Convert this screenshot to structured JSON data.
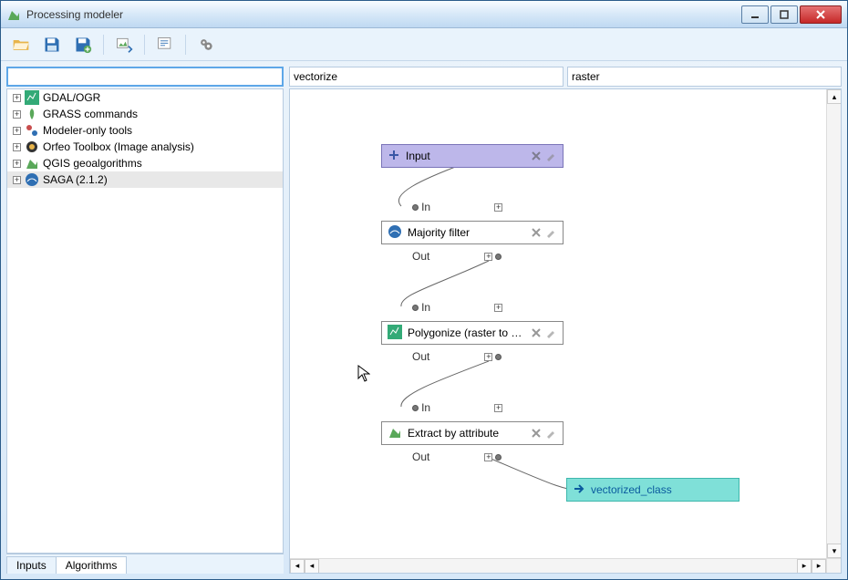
{
  "window": {
    "title": "Processing modeler"
  },
  "toolbar": {
    "open": "open-icon",
    "save": "save-icon",
    "saveas": "saveas-icon",
    "export": "export-icon",
    "run": "run-icon",
    "help": "help-icon"
  },
  "left": {
    "search_placeholder": "",
    "tree": [
      {
        "label": "GDAL/OGR",
        "icon": "gdal"
      },
      {
        "label": "GRASS commands",
        "icon": "grass"
      },
      {
        "label": "Modeler-only tools",
        "icon": "modeler"
      },
      {
        "label": "Orfeo Toolbox (Image analysis)",
        "icon": "orfeo"
      },
      {
        "label": "QGIS geoalgorithms",
        "icon": "qgis"
      },
      {
        "label": "SAGA (2.1.2)",
        "icon": "saga"
      }
    ],
    "tabs": {
      "inputs": "Inputs",
      "algorithms": "Algorithms"
    }
  },
  "top": {
    "model_name": "vectorize",
    "group_name": "raster"
  },
  "nodes": {
    "input": {
      "label": "Input"
    },
    "n1": {
      "label": "Majority filter",
      "in": "In",
      "out": "Out"
    },
    "n2": {
      "label": "Polygonize (raster to vect...",
      "in": "In",
      "out": "Out"
    },
    "n3": {
      "label": "Extract by attribute",
      "in": "In",
      "out": "Out"
    },
    "output": {
      "label": "vectorized_class"
    }
  }
}
